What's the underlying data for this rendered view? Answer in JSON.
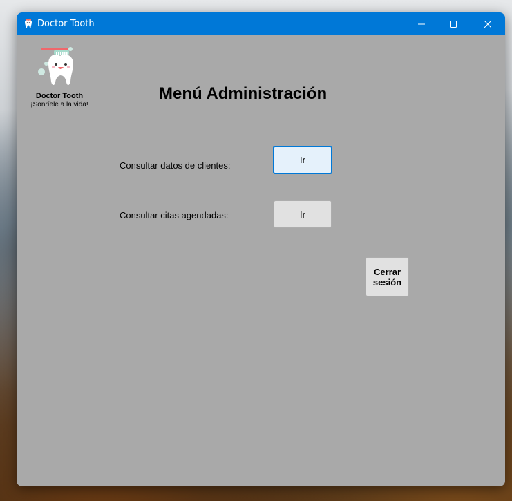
{
  "window": {
    "title": "Doctor Tooth",
    "controls": {
      "minimize_icon": "minimize-icon",
      "maximize_icon": "maximize-icon",
      "close_icon": "close-icon"
    },
    "titlebar_color": "#0078d7",
    "background_color": "#a9a9a9"
  },
  "brand": {
    "logo_icon": "tooth-logo-icon",
    "name": "Doctor Tooth",
    "tagline": "¡Sonríele a la vida!"
  },
  "main": {
    "title": "Menú Administración",
    "rows": [
      {
        "label": "Consultar datos de clientes:",
        "button_label": "Ir"
      },
      {
        "label": "Consultar citas agendadas:",
        "button_label": "Ir"
      }
    ],
    "logout": {
      "line1": "Cerrar",
      "line2": "sesión"
    }
  }
}
